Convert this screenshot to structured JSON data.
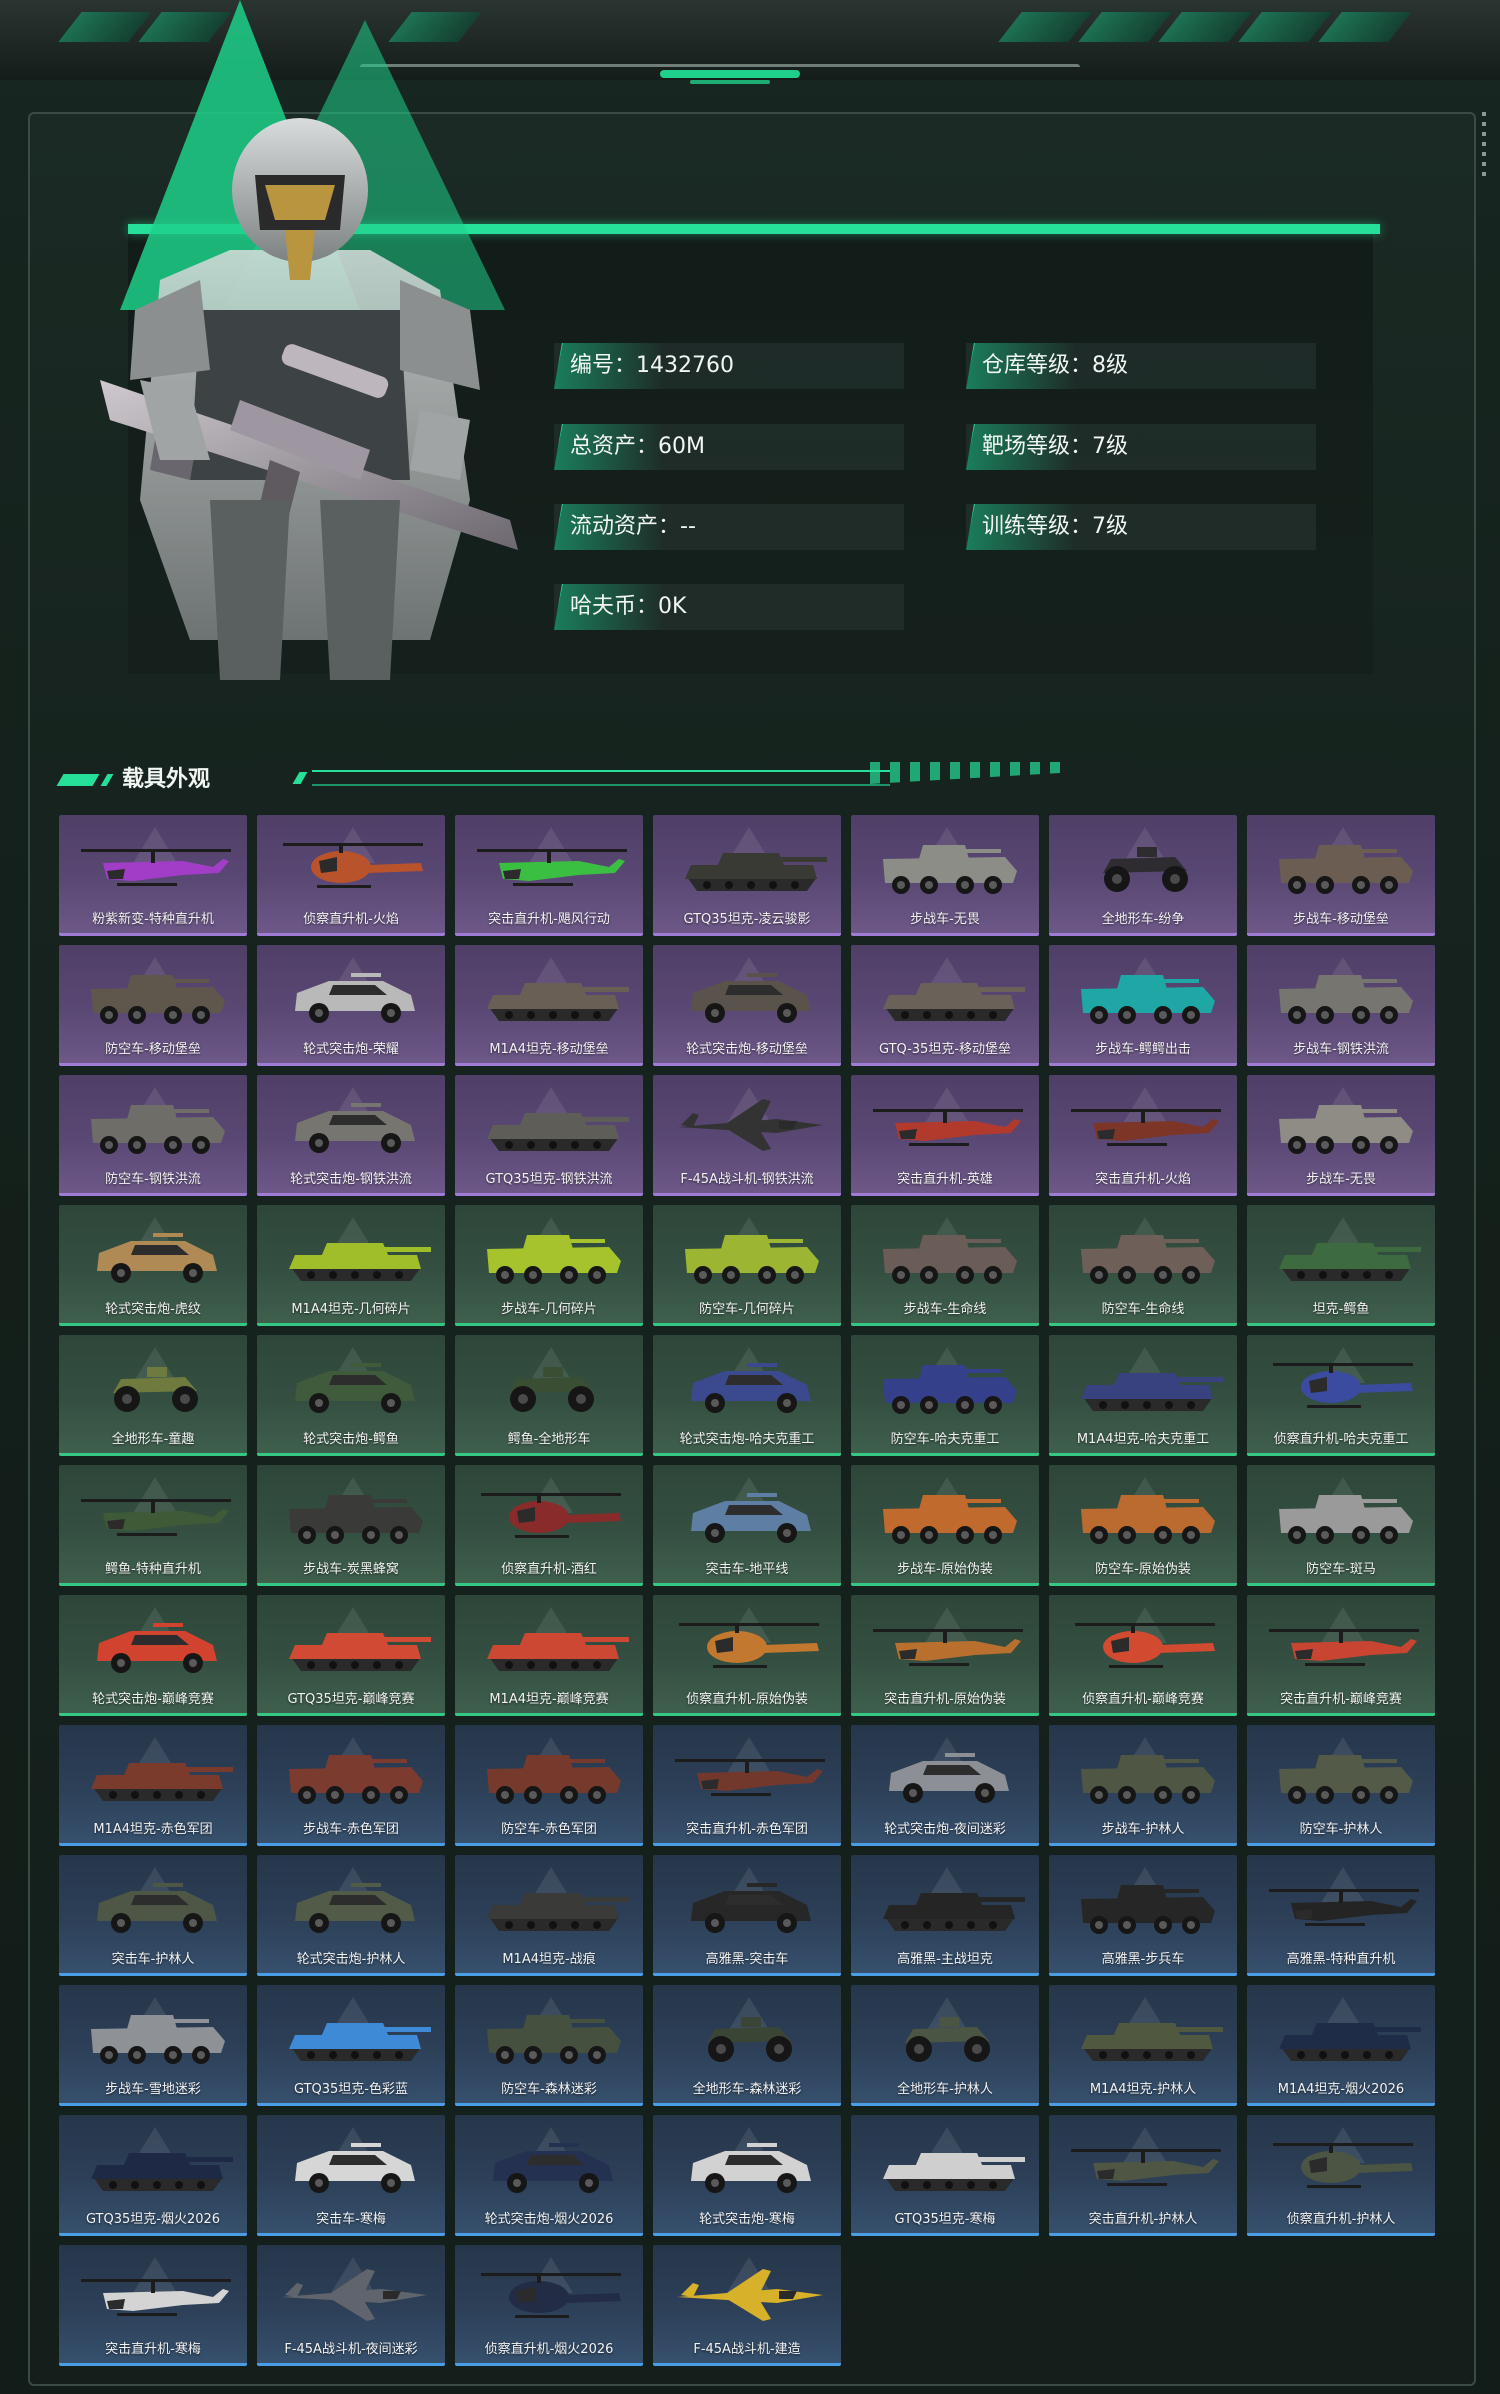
{
  "profile": {
    "stats_left": [
      {
        "label": "编号：",
        "value": "1432760"
      },
      {
        "label": "总资产：",
        "value": "60M"
      },
      {
        "label": "流动资产：",
        "value": "--"
      },
      {
        "label": "哈夫币：",
        "value": "0K"
      }
    ],
    "stats_right": [
      {
        "label": "仓库等级：",
        "value": "8级"
      },
      {
        "label": "靶场等级：",
        "value": "7级"
      },
      {
        "label": "训练等级：",
        "value": "7级"
      }
    ]
  },
  "section": {
    "title": "载具外观"
  },
  "colors": {
    "accent": "#26e09a",
    "purple": "#a17cd6",
    "green": "#33c985",
    "blue": "#4a9ee6"
  },
  "vehicles": [
    {
      "name": "粉紫新变-特种直升机",
      "tier": "purple",
      "kind": "heli",
      "color": "#a23dc7"
    },
    {
      "name": "侦察直升机-火焰",
      "tier": "purple",
      "kind": "littlebird",
      "color": "#b8532b"
    },
    {
      "name": "突击直升机-飓风行动",
      "tier": "purple",
      "kind": "heli",
      "color": "#3bbf42"
    },
    {
      "name": "GTQ35坦克-凌云骏影",
      "tier": "purple",
      "kind": "tank",
      "color": "#3a3a34"
    },
    {
      "name": "步战车-无畏",
      "tier": "purple",
      "kind": "ifv",
      "color": "#8d8d87"
    },
    {
      "name": "全地形车-纷争",
      "tier": "purple",
      "kind": "atv",
      "color": "#2e2c30"
    },
    {
      "name": "步战车-移动堡垒",
      "tier": "purple",
      "kind": "ifv",
      "color": "#6b5d52"
    },
    {
      "name": "防空车-移动堡垒",
      "tier": "purple",
      "kind": "ifv",
      "color": "#5f574c"
    },
    {
      "name": "轮式突击炮-荣耀",
      "tier": "purple",
      "kind": "car",
      "color": "#b9b9b9"
    },
    {
      "name": "M1A4坦克-移动堡垒",
      "tier": "purple",
      "kind": "tank",
      "color": "#6a5f55"
    },
    {
      "name": "轮式突击炮-移动堡垒",
      "tier": "purple",
      "kind": "car",
      "color": "#5a534b"
    },
    {
      "name": "GTQ-35坦克-移动堡垒",
      "tier": "purple",
      "kind": "tank",
      "color": "#6a6258"
    },
    {
      "name": "步战车-鳄鳄出击",
      "tier": "purple",
      "kind": "ifv",
      "color": "#1fa7a5"
    },
    {
      "name": "步战车-钢铁洪流",
      "tier": "purple",
      "kind": "ifv",
      "color": "#77756f"
    },
    {
      "name": "防空车-钢铁洪流",
      "tier": "purple",
      "kind": "ifv",
      "color": "#6f6d67"
    },
    {
      "name": "轮式突击炮-钢铁洪流",
      "tier": "purple",
      "kind": "car",
      "color": "#777570"
    },
    {
      "name": "GTQ35坦克-钢铁洪流",
      "tier": "purple",
      "kind": "tank",
      "color": "#5f5d57"
    },
    {
      "name": "F-45A战斗机-钢铁洪流",
      "tier": "purple",
      "kind": "jet",
      "color": "#333333"
    },
    {
      "name": "突击直升机-英雄",
      "tier": "purple",
      "kind": "heli",
      "color": "#b13a2d"
    },
    {
      "name": "突击直升机-火焰",
      "tier": "purple",
      "kind": "heli",
      "color": "#7d3528"
    },
    {
      "name": "步战车-无畏",
      "tier": "purple",
      "kind": "ifv",
      "color": "#8e8c85"
    },
    {
      "name": "轮式突击炮-虎纹",
      "tier": "green",
      "kind": "car",
      "color": "#b08a54"
    },
    {
      "name": "M1A4坦克-几何碎片",
      "tier": "green",
      "kind": "tank",
      "color": "#9fbe2a"
    },
    {
      "name": "步战车-几何碎片",
      "tier": "green",
      "kind": "ifv",
      "color": "#a6c22d"
    },
    {
      "name": "防空车-几何碎片",
      "tier": "green",
      "kind": "ifv",
      "color": "#9cb634"
    },
    {
      "name": "步战车-生命线",
      "tier": "green",
      "kind": "ifv",
      "color": "#6a5d57"
    },
    {
      "name": "防空车-生命线",
      "tier": "green",
      "kind": "ifv",
      "color": "#6e5f58"
    },
    {
      "name": "坦克-鳄鱼",
      "tier": "green",
      "kind": "tank",
      "color": "#3d6b3f"
    },
    {
      "name": "全地形车-童趣",
      "tier": "green",
      "kind": "atv",
      "color": "#6e7a3e"
    },
    {
      "name": "轮式突击炮-鳄鱼",
      "tier": "green",
      "kind": "car",
      "color": "#3f5b3b"
    },
    {
      "name": "鳄鱼-全地形车",
      "tier": "green",
      "kind": "atv",
      "color": "#3a4e34"
    },
    {
      "name": "轮式突击炮-哈夫克重工",
      "tier": "green",
      "kind": "car",
      "color": "#3b4a8e"
    },
    {
      "name": "防空车-哈夫克重工",
      "tier": "green",
      "kind": "ifv",
      "color": "#34408a"
    },
    {
      "name": "M1A4坦克-哈夫克重工",
      "tier": "green",
      "kind": "tank",
      "color": "#38427f"
    },
    {
      "name": "侦察直升机-哈夫克重工",
      "tier": "green",
      "kind": "littlebird",
      "color": "#3a4ba0"
    },
    {
      "name": "鳄鱼-特种直升机",
      "tier": "green",
      "kind": "heli",
      "color": "#3e5a36"
    },
    {
      "name": "步战车-炭黑蜂窝",
      "tier": "green",
      "kind": "ifv",
      "color": "#3a3a38"
    },
    {
      "name": "侦察直升机-酒红",
      "tier": "green",
      "kind": "littlebird",
      "color": "#8a2b2b"
    },
    {
      "name": "突击车-地平线",
      "tier": "green",
      "kind": "car",
      "color": "#5f7ea3"
    },
    {
      "name": "步战车-原始伪装",
      "tier": "green",
      "kind": "ifv",
      "color": "#c06a2e"
    },
    {
      "name": "防空车-原始伪装",
      "tier": "green",
      "kind": "ifv",
      "color": "#bb6b30"
    },
    {
      "name": "防空车-斑马",
      "tier": "green",
      "kind": "ifv",
      "color": "#9a9a9a"
    },
    {
      "name": "轮式突击炮-巅峰竞赛",
      "tier": "green",
      "kind": "car",
      "color": "#d1432e"
    },
    {
      "name": "GTQ35坦克-巅峰竞赛",
      "tier": "green",
      "kind": "tank",
      "color": "#d04a34"
    },
    {
      "name": "M1A4坦克-巅峰竞赛",
      "tier": "green",
      "kind": "tank",
      "color": "#cc4833"
    },
    {
      "name": "侦察直升机-原始伪装",
      "tier": "green",
      "kind": "littlebird",
      "color": "#c2782e"
    },
    {
      "name": "突击直升机-原始伪装",
      "tier": "green",
      "kind": "heli",
      "color": "#b9702e"
    },
    {
      "name": "侦察直升机-巅峰竞赛",
      "tier": "green",
      "kind": "littlebird",
      "color": "#d24a2f"
    },
    {
      "name": "突击直升机-巅峰竞赛",
      "tier": "green",
      "kind": "heli",
      "color": "#c84531"
    },
    {
      "name": "M1A4坦克-赤色军团",
      "tier": "blue",
      "kind": "tank",
      "color": "#7a3a2c"
    },
    {
      "name": "步战车-赤色军团",
      "tier": "blue",
      "kind": "ifv",
      "color": "#7b3b2e"
    },
    {
      "name": "防空车-赤色军团",
      "tier": "blue",
      "kind": "ifv",
      "color": "#763a2d"
    },
    {
      "name": "突击直升机-赤色军团",
      "tier": "blue",
      "kind": "heli",
      "color": "#72382c"
    },
    {
      "name": "轮式突击炮-夜间迷彩",
      "tier": "blue",
      "kind": "car",
      "color": "#8c9096"
    },
    {
      "name": "步战车-护林人",
      "tier": "blue",
      "kind": "ifv",
      "color": "#4f5744"
    },
    {
      "name": "防空车-护林人",
      "tier": "blue",
      "kind": "ifv",
      "color": "#535a47"
    },
    {
      "name": "突击车-护林人",
      "tier": "blue",
      "kind": "car",
      "color": "#4e5645"
    },
    {
      "name": "轮式突击炮-护林人",
      "tier": "blue",
      "kind": "car",
      "color": "#525a48"
    },
    {
      "name": "M1A4坦克-战痕",
      "tier": "blue",
      "kind": "tank",
      "color": "#3a3a38"
    },
    {
      "name": "高雅黑-突击车",
      "tier": "blue",
      "kind": "car",
      "color": "#272727"
    },
    {
      "name": "高雅黑-主战坦克",
      "tier": "blue",
      "kind": "tank",
      "color": "#252525"
    },
    {
      "name": "高雅黑-步兵车",
      "tier": "blue",
      "kind": "ifv",
      "color": "#262626"
    },
    {
      "name": "高雅黑-特种直升机",
      "tier": "blue",
      "kind": "heli",
      "color": "#242424"
    },
    {
      "name": "步战车-雪地迷彩",
      "tier": "blue",
      "kind": "ifv",
      "color": "#8e9296"
    },
    {
      "name": "GTQ35坦克-色彩蓝",
      "tier": "blue",
      "kind": "tank",
      "color": "#3f8ad6"
    },
    {
      "name": "防空车-森林迷彩",
      "tier": "blue",
      "kind": "ifv",
      "color": "#46503f"
    },
    {
      "name": "全地形车-森林迷彩",
      "tier": "blue",
      "kind": "atv",
      "color": "#3b4536"
    },
    {
      "name": "全地形车-护林人",
      "tier": "blue",
      "kind": "atv",
      "color": "#4b5543"
    },
    {
      "name": "M1A4坦克-护林人",
      "tier": "blue",
      "kind": "tank",
      "color": "#50583f"
    },
    {
      "name": "M1A4坦克-烟火2026",
      "tier": "blue",
      "kind": "tank",
      "color": "#1f2c48"
    },
    {
      "name": "GTQ35坦克-烟火2026",
      "tier": "blue",
      "kind": "tank",
      "color": "#1e2a45"
    },
    {
      "name": "突击车-寒梅",
      "tier": "blue",
      "kind": "car",
      "color": "#d6d6d6"
    },
    {
      "name": "轮式突击炮-烟火2026",
      "tier": "blue",
      "kind": "car",
      "color": "#243150"
    },
    {
      "name": "轮式突击炮-寒梅",
      "tier": "blue",
      "kind": "car",
      "color": "#d2d2d2"
    },
    {
      "name": "GTQ35坦克-寒梅",
      "tier": "blue",
      "kind": "tank",
      "color": "#cfcfcf"
    },
    {
      "name": "突击直升机-护林人",
      "tier": "blue",
      "kind": "heli",
      "color": "#4f5744"
    },
    {
      "name": "侦察直升机-护林人",
      "tier": "blue",
      "kind": "littlebird",
      "color": "#4c5443"
    },
    {
      "name": "突击直升机-寒梅",
      "tier": "blue",
      "kind": "heli",
      "color": "#d4d4d4"
    },
    {
      "name": "F-45A战斗机-夜间迷彩",
      "tier": "blue",
      "kind": "jet",
      "color": "#60646c"
    },
    {
      "name": "侦察直升机-烟火2026",
      "tier": "blue",
      "kind": "littlebird",
      "color": "#222c44"
    },
    {
      "name": "F-45A战斗机-建造",
      "tier": "blue",
      "kind": "jet",
      "color": "#d8b12a"
    }
  ]
}
